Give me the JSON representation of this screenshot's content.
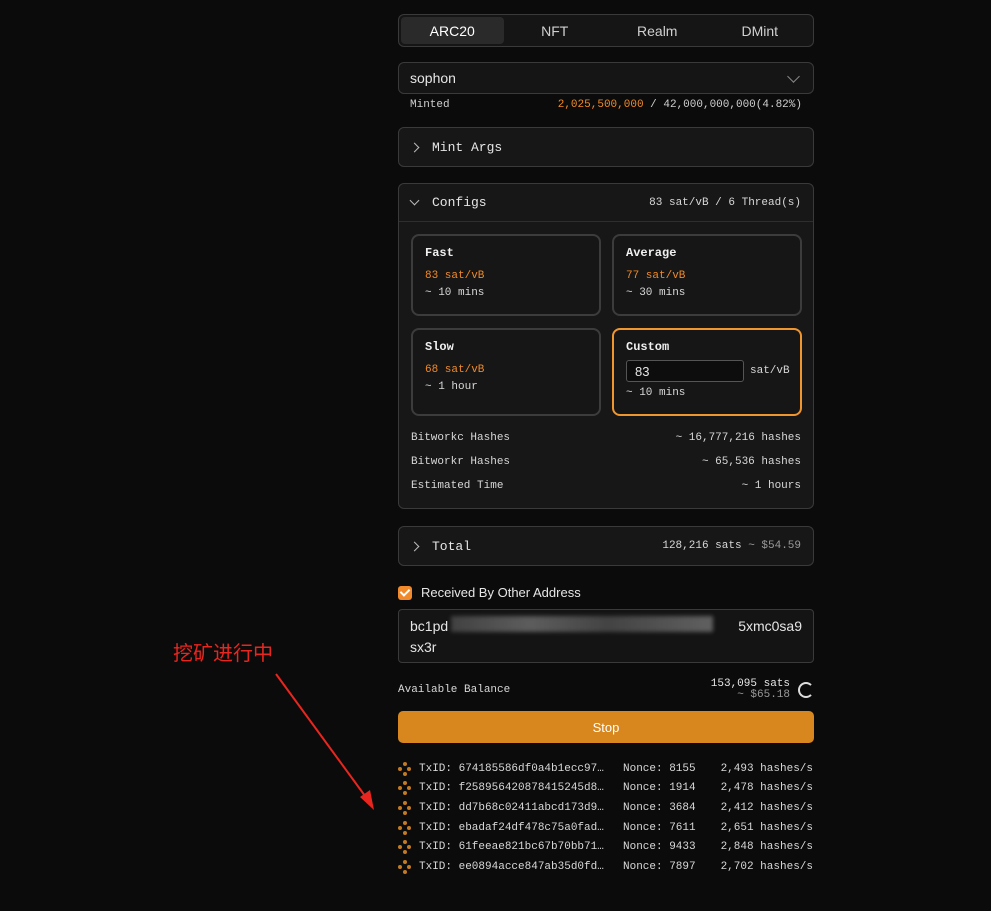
{
  "tabs": [
    {
      "label": "ARC20",
      "active": true
    },
    {
      "label": "NFT",
      "active": false
    },
    {
      "label": "Realm",
      "active": false
    },
    {
      "label": "DMint",
      "active": false
    }
  ],
  "token_select": {
    "value": "sophon"
  },
  "minted": {
    "label": "Minted",
    "amount": "2,025,500,000",
    "total": " / 42,000,000,000(4.82%)"
  },
  "mint_args": {
    "title": "Mint Args"
  },
  "configs": {
    "title": "Configs",
    "summary": "83 sat/vB / 6 Thread(s)",
    "cards": [
      {
        "title": "Fast",
        "rate": "83 sat/vB",
        "time": "~ 10 mins"
      },
      {
        "title": "Average",
        "rate": "77 sat/vB",
        "time": "~ 30 mins"
      },
      {
        "title": "Slow",
        "rate": "68 sat/vB",
        "time": "~ 1 hour"
      }
    ],
    "custom": {
      "title": "Custom",
      "value": "83",
      "unit": "sat/vB",
      "time": "~ 10 mins"
    },
    "stats": [
      {
        "label": "Bitworkc Hashes",
        "value": "~ 16,777,216 hashes"
      },
      {
        "label": "Bitworkr Hashes",
        "value": "~ 65,536 hashes"
      },
      {
        "label": "Estimated Time",
        "value": "~ 1 hours"
      }
    ]
  },
  "total": {
    "title": "Total",
    "sats": "128,216 sats",
    "usd": "~ $54.59"
  },
  "receive": {
    "label": "Received By Other Address",
    "checked": true,
    "address_start": "bc1pd",
    "address_end": "5xmc0sa9",
    "address_line2": "sx3r"
  },
  "balance": {
    "label": "Available Balance",
    "sats": "153,095 sats",
    "usd": "~ $65.18"
  },
  "stop_button": "Stop",
  "transactions": [
    {
      "txid": "TxID: 674185586df0a4b1ecc97…",
      "nonce": "Nonce: 8155",
      "rate": "2,493 hashes/s"
    },
    {
      "txid": "TxID: f258956420878415245d8…",
      "nonce": "Nonce: 1914",
      "rate": "2,478 hashes/s"
    },
    {
      "txid": "TxID: dd7b68c02411abcd173d9…",
      "nonce": "Nonce: 3684",
      "rate": "2,412 hashes/s"
    },
    {
      "txid": "TxID: ebadaf24df478c75a0fad…",
      "nonce": "Nonce: 7611",
      "rate": "2,651 hashes/s"
    },
    {
      "txid": "TxID: 61feeae821bc67b70bb71…",
      "nonce": "Nonce: 9433",
      "rate": "2,848 hashes/s"
    },
    {
      "txid": "TxID: ee0894acce847ab35d0fd…",
      "nonce": "Nonce: 7897",
      "rate": "2,702 hashes/s"
    }
  ],
  "annotation": "挖矿进行中",
  "colors": {
    "accent": "#f08a2a",
    "stop_button": "#d8871f",
    "annotation": "#e8261f"
  }
}
